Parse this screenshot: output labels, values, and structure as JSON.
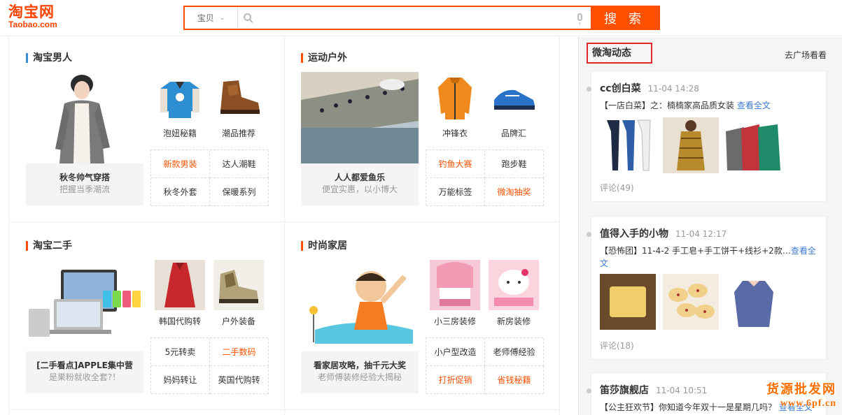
{
  "header": {
    "logo_cn": "淘宝网",
    "logo_en": "Taobao.com",
    "search_category": "宝贝",
    "search_placeholder": "",
    "search_button": "搜 索"
  },
  "sections": [
    {
      "title": "淘宝男人",
      "feature": {
        "title": "秋冬帅气穿搭",
        "subtitle": "把握当季潮流"
      },
      "thumbs": [
        {
          "label": "泡妞秘籍"
        },
        {
          "label": "潮品推荐"
        }
      ],
      "tags": [
        {
          "label": "新款男装"
        },
        {
          "label": "达人潮鞋"
        },
        {
          "label": "秋冬外套"
        },
        {
          "label": "保暖系列"
        }
      ]
    },
    {
      "title": "运动户外",
      "feature": {
        "title": "人人都爱鱼乐",
        "subtitle": "便宜实惠，以小博大"
      },
      "thumbs": [
        {
          "label": "冲锋衣"
        },
        {
          "label": "品牌汇"
        }
      ],
      "tags": [
        {
          "label": "钓鱼大赛"
        },
        {
          "label": "跑步鞋"
        },
        {
          "label": "万能标签"
        },
        {
          "label": "微淘抽奖"
        }
      ]
    },
    {
      "title": "淘宝二手",
      "feature": {
        "title": "[二手看点]APPLE集中营",
        "subtitle": "是果粉就收全套?！"
      },
      "thumbs": [
        {
          "label": "韩国代购转"
        },
        {
          "label": "户外装备"
        }
      ],
      "tags": [
        {
          "label": "5元转卖"
        },
        {
          "label": "二手数码"
        },
        {
          "label": "妈妈转让"
        },
        {
          "label": "英国代购转"
        }
      ]
    },
    {
      "title": "时尚家居",
      "feature": {
        "title": "看家居攻略，抽千元大奖",
        "subtitle": "老师傅装修经验大揭秘"
      },
      "thumbs": [
        {
          "label": "小三房装修"
        },
        {
          "label": "新房装修"
        }
      ],
      "tags": [
        {
          "label": "小户型改造"
        },
        {
          "label": "老师傅经验"
        },
        {
          "label": "打折促销"
        },
        {
          "label": "省钱秘籍"
        }
      ]
    }
  ],
  "weitao": {
    "title": "微淘动态",
    "more": "去广场看看",
    "cards": [
      {
        "name": "cc创白菜",
        "time": "11-04 14:28",
        "text": "【一店白菜】之：楠楠家高品质女装 ",
        "link": "查看全文",
        "comments": "评论(49)"
      },
      {
        "name": "值得入手的小物",
        "time": "11-04 12:17",
        "text": "【恐怖团】11-4-2 手工皂+手工饼干+线衫+2款…",
        "link": "查看全文",
        "comments": "评论(18)"
      },
      {
        "name": "笛莎旗舰店",
        "time": "11-04 10:51",
        "text": "【公主狂欢节】你知道今年双十一是星期几吗？ ",
        "link": "查看全文",
        "comments": ""
      }
    ]
  },
  "watermark": {
    "cn": "货源批发网",
    "url": "www.6pf.cn"
  },
  "colors": {
    "brand": "#ff5000",
    "link": "#3c7bd6",
    "highlight_border": "#e2272a"
  }
}
